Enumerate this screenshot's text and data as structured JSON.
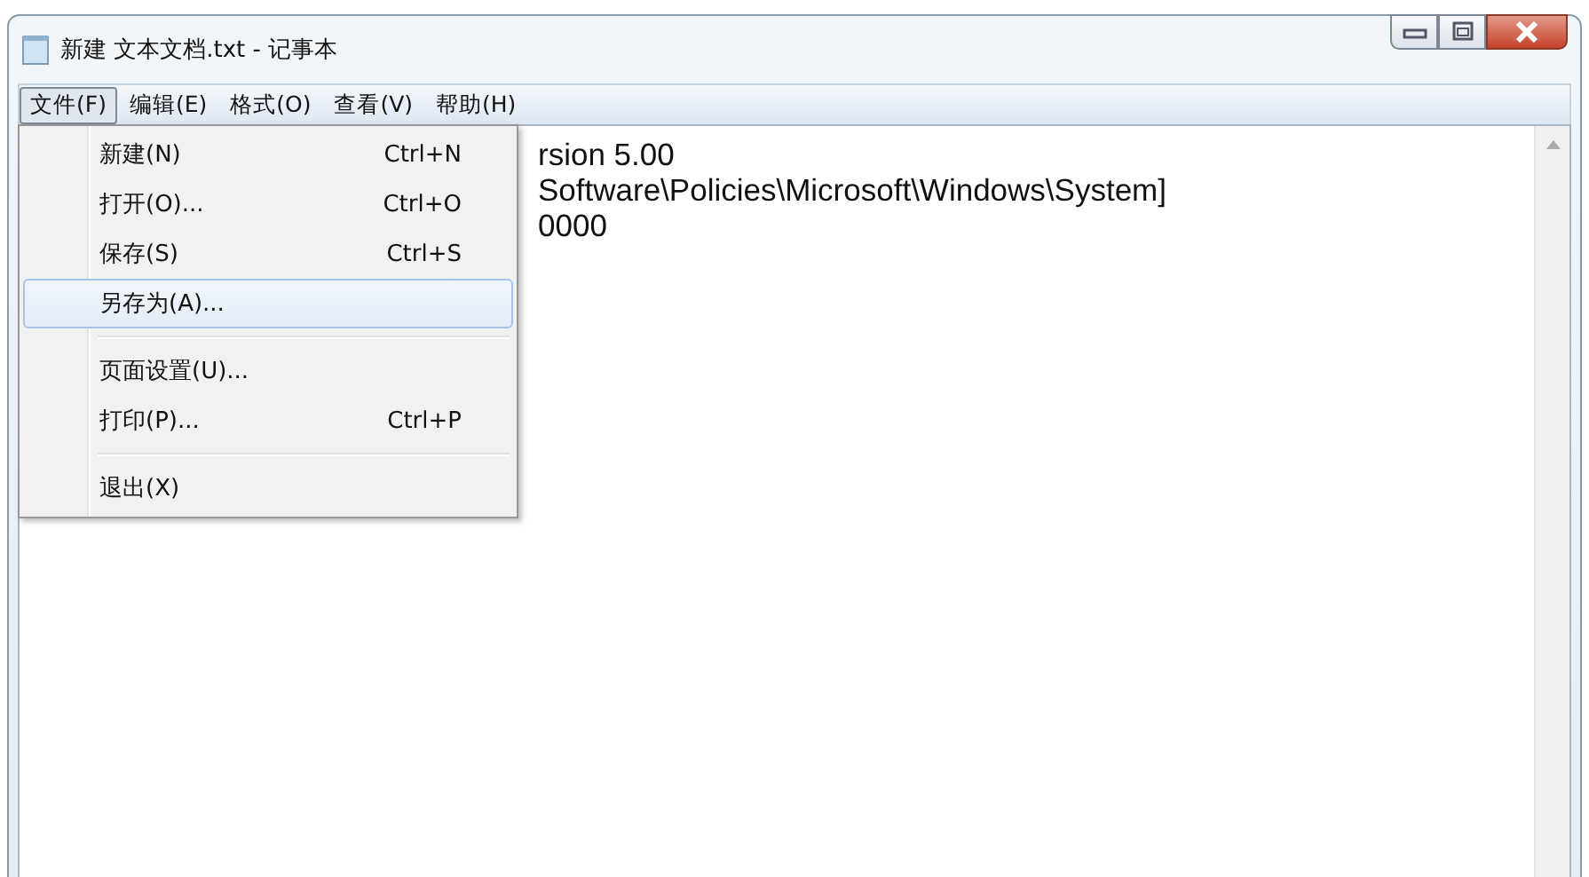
{
  "window": {
    "title": "新建 文本文档.txt - 记事本"
  },
  "menu_bar": [
    {
      "label": "文件(F)",
      "selected": true
    },
    {
      "label": "编辑(E)",
      "selected": false
    },
    {
      "label": "格式(O)",
      "selected": false
    },
    {
      "label": "查看(V)",
      "selected": false
    },
    {
      "label": "帮助(H)",
      "selected": false
    }
  ],
  "file_menu": [
    {
      "kind": "item",
      "label": "新建(N)",
      "shortcut": "Ctrl+N",
      "selected": false
    },
    {
      "kind": "item",
      "label": "打开(O)...",
      "shortcut": "Ctrl+O",
      "selected": false
    },
    {
      "kind": "item",
      "label": "保存(S)",
      "shortcut": "Ctrl+S",
      "selected": false
    },
    {
      "kind": "item",
      "label": "另存为(A)...",
      "selected": true
    },
    {
      "kind": "separator"
    },
    {
      "kind": "item",
      "label": "页面设置(U)...",
      "selected": false
    },
    {
      "kind": "item",
      "label": "打印(P)...",
      "shortcut": "Ctrl+P",
      "selected": false
    },
    {
      "kind": "separator"
    },
    {
      "kind": "item",
      "label": "退出(X)",
      "selected": false
    }
  ],
  "editor": {
    "lines": [
      "rsion 5.00",
      "Software\\Policies\\Microsoft\\Windows\\System]",
      "0000"
    ]
  }
}
